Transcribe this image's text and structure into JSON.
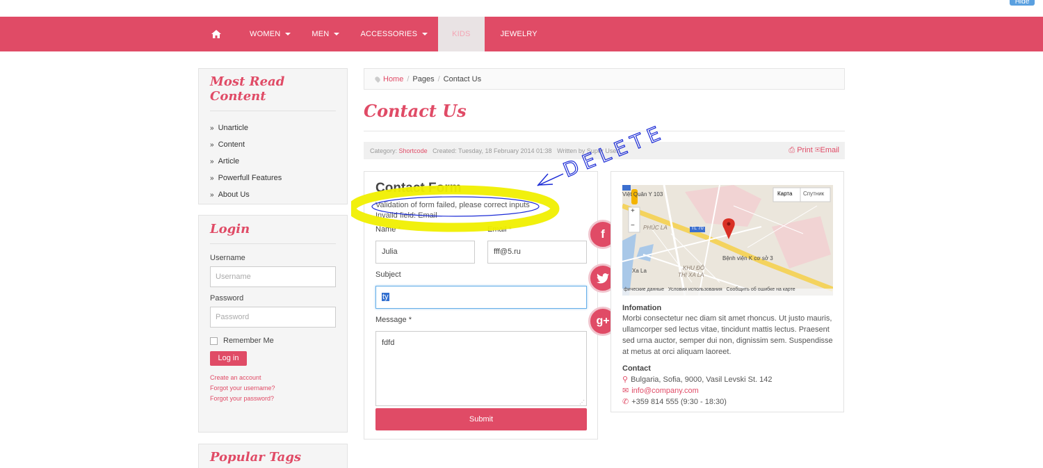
{
  "topbar": {
    "hide_label": "Hide"
  },
  "nav": {
    "items": [
      {
        "label": "WOMEN",
        "dropdown": true
      },
      {
        "label": "MEN",
        "dropdown": true
      },
      {
        "label": "ACCESSORIES",
        "dropdown": true
      },
      {
        "label": "KIDS",
        "active": true
      },
      {
        "label": "JEWELRY"
      }
    ]
  },
  "sidebar": {
    "most_read": {
      "title": "Most Read Content",
      "items": [
        "Unarticle",
        "Content",
        "Article",
        "Powerfull Features",
        "About Us"
      ]
    },
    "login": {
      "title": "Login",
      "username_label": "Username",
      "username_placeholder": "Username",
      "password_label": "Password",
      "password_placeholder": "Password",
      "remember_label": "Remember Me",
      "login_button": "Log in",
      "links": [
        "Create an account",
        "Forgot your username?",
        "Forgot your password?"
      ]
    },
    "tags": {
      "title": "Popular Tags"
    }
  },
  "breadcrumb": {
    "home": "Home",
    "pages": "Pages",
    "current": "Contact Us"
  },
  "page_title": "Contact Us",
  "meta": {
    "category_label": "Category:",
    "category_value": "Shortcode",
    "created": "Created: Tuesday, 18 February 2014 01:38",
    "written": "Written by Super User",
    "print": "Print",
    "email": "Email"
  },
  "contact_form": {
    "title": "Contact Form",
    "error_1": "Validation of form failed, please correct inputs",
    "error_2": "Invalid field: Email",
    "name_label": "Name *",
    "name_value": "Julia",
    "email_label": "Email *",
    "email_value": "fff@5.ru",
    "subject_label": "Subject",
    "subject_value": "ty",
    "message_label": "Message *",
    "message_value": "fdfd",
    "submit": "Submit"
  },
  "social": [
    {
      "icon": "facebook-icon",
      "glyph": "f"
    },
    {
      "icon": "twitter-icon",
      "glyph": "t"
    },
    {
      "icon": "google-plus-icon",
      "glyph": "g+"
    }
  ],
  "map": {
    "btn_map": "Карта",
    "btn_satellite": "Спутник",
    "labels": [
      "Việt Quân Y 103",
      "PHÚC LA",
      "TL 70",
      "Bệnh viện K cơ sở 3",
      "Xa La",
      "KHU ĐÔ",
      "THỊ XA LA"
    ],
    "footer": [
      "фические данные",
      "Условия использования",
      "Сообщить об ошибке на карте"
    ]
  },
  "info": {
    "info_title": "Infomation",
    "info_text": "Morbi consectetur nec diam sit amet rhoncus. Ut justo mauris, ullamcorper sed lectus vitae, tincidunt mattis lectus. Praesent sed urna auctor, semper dui non, dignissim sem. Suspendisse at metus at orci aliquam laoreet.",
    "contact_title": "Contact",
    "address": "Bulgaria, Sofia, 9000, Vasil Levski St. 142",
    "email": "info@company.com",
    "phone": "+359 814 555 (9:30 - 18:30)"
  },
  "annotation": {
    "text": "DELETE"
  },
  "colors": {
    "brand": "#e04b66",
    "highlight": "#f0ef00",
    "annotation_ink": "#1b2bd6"
  }
}
